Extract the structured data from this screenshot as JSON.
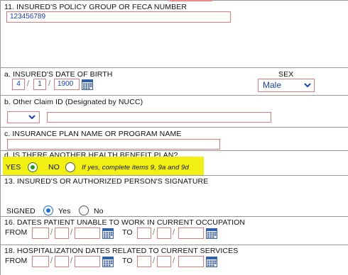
{
  "sec11": {
    "label": "11. INSURED'S POLICY GROUP OR FECA NUMBER",
    "value": "123456789"
  },
  "sec11a": {
    "label": "a. INSURED'S DATE OF BIRTH",
    "month": "4",
    "day": "1",
    "year": "1900",
    "sex_label": "SEX",
    "sex_value": "Male"
  },
  "sec11b": {
    "label": "b. Other Claim ID (Designated by NUCC)",
    "qualifier_value": "",
    "claim_id_value": ""
  },
  "sec11c": {
    "label": "c. INSURANCE PLAN NAME OR PROGRAM NAME",
    "value": ""
  },
  "sec11d": {
    "label": "d. IS THERE ANOTHER HEALTH BENEFIT PLAN?",
    "yes_label": "YES",
    "no_label": "NO",
    "note": "If yes, complete items 9, 9a and 9d",
    "selected": "yes"
  },
  "sec13": {
    "label": "13. INSURED'S OR AUTHORIZED PERSON'S SIGNATURE",
    "signed_label": "SIGNED",
    "yes_label": "Yes",
    "no_label": "No",
    "selected": "yes"
  },
  "sec16": {
    "label": "16. DATES PATIENT UNABLE TO WORK IN CURRENT OCCUPATION",
    "from_label": "FROM",
    "to_label": "TO",
    "from": {
      "month": "",
      "day": "",
      "year": ""
    },
    "to": {
      "month": "",
      "day": "",
      "year": ""
    }
  },
  "sec18": {
    "label": "18. HOSPITALIZATION DATES RELATED TO CURRENT SERVICES",
    "from_label": "FROM",
    "to_label": "TO",
    "from": {
      "month": "",
      "day": "",
      "year": ""
    },
    "to": {
      "month": "",
      "day": "",
      "year": ""
    }
  },
  "icons": {
    "calendar": "calendar-icon",
    "dropdown": "chevron-down-icon"
  },
  "colors": {
    "field_border": "#e07a7a",
    "value_text": "#1a3fbf",
    "highlight": "#f2ef12",
    "radio_selected": "#1a6fd6",
    "radio_green": "#2a9a1a"
  }
}
